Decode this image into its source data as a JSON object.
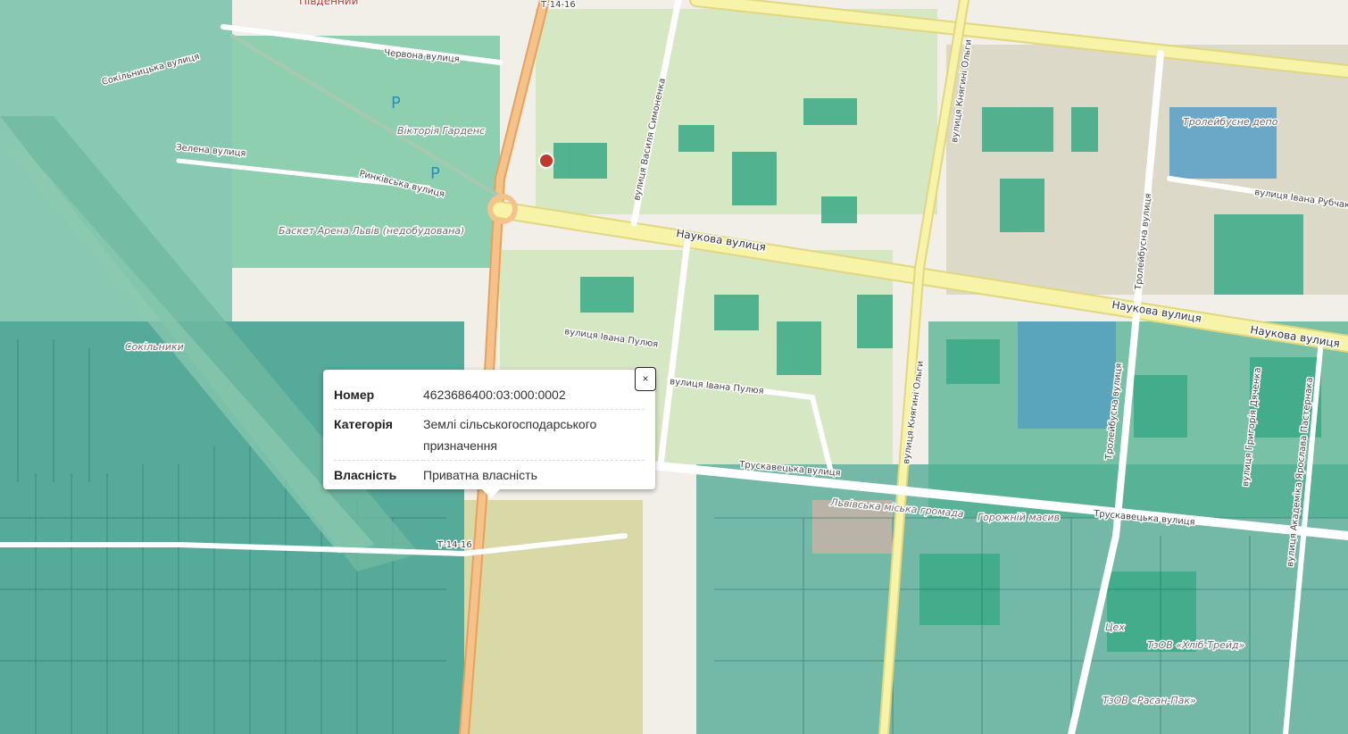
{
  "map": {
    "labels": {
      "naukova_1": "Наукова вулиця",
      "naukova_2": "Наукова вулиця",
      "naukova_3": "Наукова вулиця",
      "truskavetska_1": "Трускавецька вулиця",
      "truskavetska_2": "Трускавецька вулиця",
      "pului_1": "вулиця Івана Пулюя",
      "pului_2": "вулиця Івана Пулюя",
      "symonenka": "вулиця Василя Симоненка",
      "olhy_1": "вулиця Княгині Ольги",
      "olhy_2": "вулиця Княгині Ольги",
      "trolley_1": "Тролейбусна вулиця",
      "trolley_2": "Тролейбусна вулиця",
      "ruban": "вулиця Івана Рубчака",
      "hryhoriia": "вулиця Григорія Дяченка",
      "pasternak": "вулиця Академіка Ярослава Пастернака",
      "chervona": "Червона вулиця",
      "sokilnytska": "Сокільницька вулиця",
      "zelena": "Зелена вулиця",
      "rynkova": "Ринківська вулиця",
      "pivdennyi": "Південний",
      "victoria": "Вікторія Гарденс",
      "arena": "Баскет Арена Львів (недобудована)",
      "trolley_depot": "Тролейбусне депо",
      "sokilnyky": "Сокільники",
      "hromada": "Львівська міська громада",
      "horozhnyi": "Горожній масив",
      "t1416_top": "Т-14-16",
      "t1416_bottom": "Т-14-16",
      "tsekh": "Цех",
      "khlib": "ТзОВ «Хліб-Трейд»",
      "rasan": "ТзОВ «Расан-Пак»",
      "parking_1": "P",
      "parking_2": "P"
    }
  },
  "popup": {
    "rows": [
      {
        "label": "Номер",
        "value_lines": [
          "4623686400:03:000:0002"
        ]
      },
      {
        "label": "Категорія",
        "value_lines": [
          "Землі сільськогосподарського",
          "призначення"
        ]
      },
      {
        "label": "Власність",
        "value_lines": [
          "Приватна власність"
        ]
      }
    ],
    "close_label": "×"
  }
}
